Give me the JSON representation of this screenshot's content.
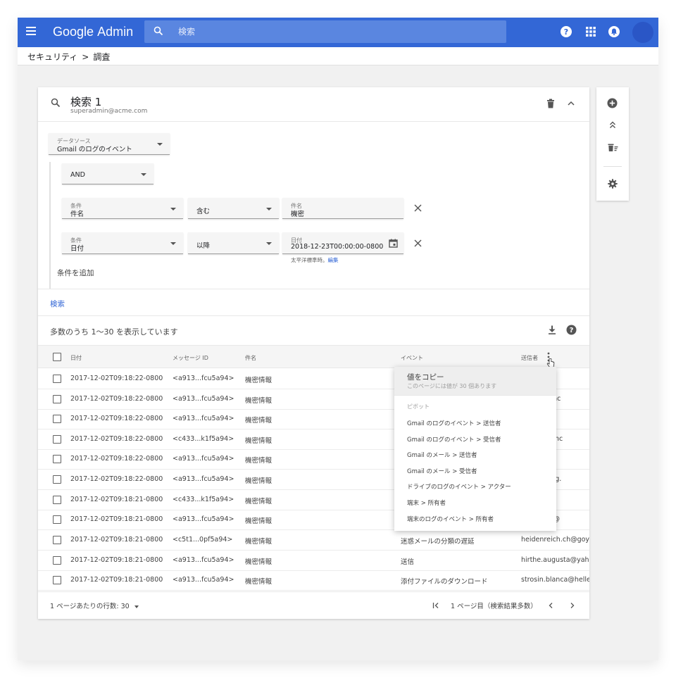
{
  "topbar": {
    "brand_google": "Google",
    "brand_admin": "Admin",
    "search_placeholder": "検索"
  },
  "breadcrumb": {
    "parent": "セキュリティ",
    "separator": ">",
    "current": "調査"
  },
  "search_card": {
    "title": "検索 1",
    "subtitle": "superadmin@acme.com",
    "datasource": {
      "label": "データソース",
      "value": "Gmail のログのイベント"
    },
    "operator": "AND",
    "conditions": [
      {
        "field_label": "条件",
        "field_value": "件名",
        "op": "含む",
        "value_label": "件名",
        "value": "機密"
      },
      {
        "field_label": "条件",
        "field_value": "日付",
        "op": "以降",
        "value_label": "日付",
        "value": "2018-12-23T00:00:00-0800"
      }
    ],
    "timezone_note": "太平洋標準時。",
    "timezone_edit": "編集",
    "add_condition": "条件を追加",
    "search_button": "検索"
  },
  "results": {
    "showing": "多数のうち 1〜30 を表示しています",
    "columns": [
      "日付",
      "メッセージ ID",
      "件名",
      "イベント",
      "送信者"
    ],
    "rows": [
      {
        "date": "2017-12-02T09:18:22-0800",
        "msgid": "<a913...fcu5a94>",
        "subject": "機密情報",
        "event": "",
        "sender": "w@sam.bi"
      },
      {
        "date": "2017-12-02T09:18:22-0800",
        "msgid": "<a913...fcu5a94>",
        "subject": "機密情報",
        "event": "",
        "sender": "ad.m@yahc"
      },
      {
        "date": "2017-12-02T09:18:22-0800",
        "msgid": "<a913...fcu5a94>",
        "subject": "機密情報",
        "event": "",
        "sender": "c@pietro.c"
      },
      {
        "date": "2017-12-02T09:18:22-0800",
        "msgid": "<c433...k1f5a94>",
        "subject": "機密情報",
        "event": "",
        "sender": "@gerlach.nc"
      },
      {
        "date": "2017-12-02T09:18:22-0800",
        "msgid": "<a913...fcu5a94>",
        "subject": "機密情報",
        "event": "",
        "sender": "i_nm@geo"
      },
      {
        "date": "2017-12-02T09:18:22-0800",
        "msgid": "<a913...fcu5a94>",
        "subject": "機密情報",
        "event": "",
        "sender": "man@haag."
      },
      {
        "date": "2017-12-02T09:18:21-0800",
        "msgid": "<c433...k1f5a94>",
        "subject": "機密情報",
        "event": "",
        "sender": "ros@angel"
      },
      {
        "date": "2017-12-02T09:18:21-0800",
        "msgid": "<a913...fcu5a94>",
        "subject": "機密情報",
        "event": "",
        "sender": "anner_fer@"
      },
      {
        "date": "2017-12-02T09:18:21-0800",
        "msgid": "<c5t1...0pf5a94>",
        "subject": "機密情報",
        "event": "迷惑メールの分類の遅延",
        "sender": "heidenreich.ch@goyet"
      },
      {
        "date": "2017-12-02T09:18:21-0800",
        "msgid": "<a913...fcu5a94>",
        "subject": "機密情報",
        "event": "送信",
        "sender": "hirthe.augusta@yahoo"
      },
      {
        "date": "2017-12-02T09:18:21-0800",
        "msgid": "<a913...fcu5a94>",
        "subject": "機密情報",
        "event": "添付ファイルのダウンロード",
        "sender": "strosin.blanca@heller."
      }
    ],
    "rows_per_page": "1 ページあたりの行数: 30",
    "page_label": "1 ページ目（検索結果多数）"
  },
  "context_menu": {
    "copy_title": "値をコピー",
    "copy_sub": "このページには値が 30 個あります",
    "pivot_header": "ピボット",
    "items": [
      "Gmail のログのイベント > 送信者",
      "Gmail のログのイベント > 受信者",
      "Gmail のメール > 送信者",
      "Gmail のメール > 受信者",
      "ドライブのログのイベント > アクター",
      "端末 > 所有者",
      "端末のログのイベント > 所有者"
    ]
  },
  "colors": {
    "topbar": "#3367d6",
    "search_bg": "#5a86e0",
    "link": "#3367d6",
    "page_bg": "#f1f1f1"
  }
}
